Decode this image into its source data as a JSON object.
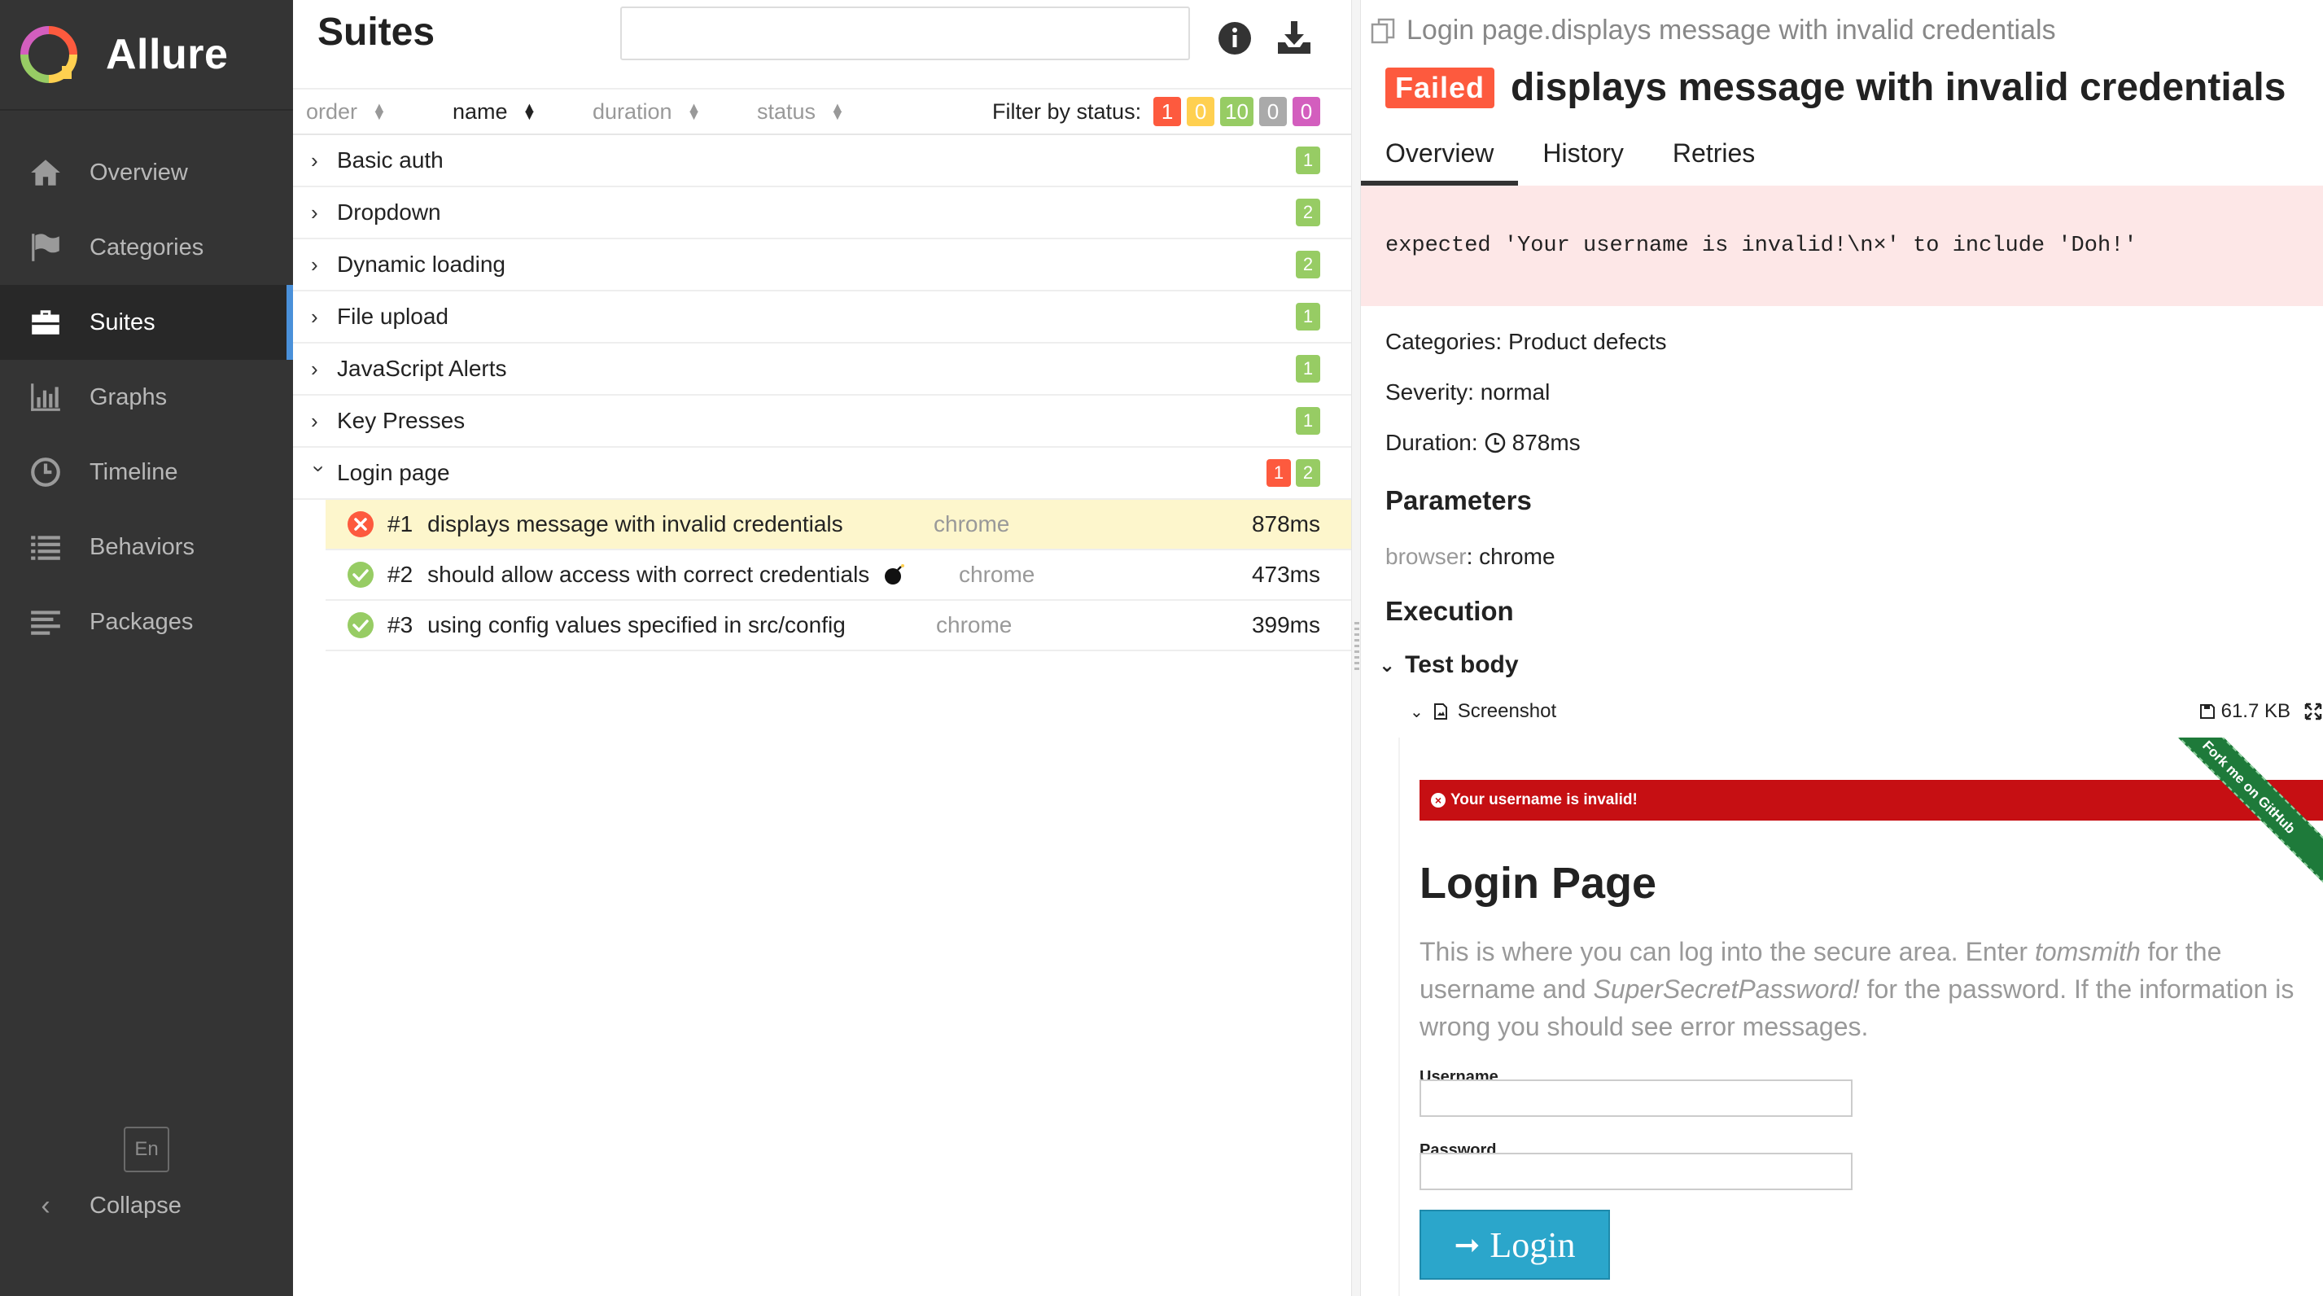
{
  "sidebar": {
    "brand": "Allure",
    "items": [
      {
        "label": "Overview",
        "icon": "home-icon"
      },
      {
        "label": "Categories",
        "icon": "flag-icon"
      },
      {
        "label": "Suites",
        "icon": "briefcase-icon",
        "active": true
      },
      {
        "label": "Graphs",
        "icon": "bar-chart-icon"
      },
      {
        "label": "Timeline",
        "icon": "clock-icon"
      },
      {
        "label": "Behaviors",
        "icon": "list-icon"
      },
      {
        "label": "Packages",
        "icon": "align-left-icon"
      }
    ],
    "language": "En",
    "collapse": "Collapse"
  },
  "suites": {
    "title": "Suites",
    "search_value": "",
    "sort": {
      "order": "order",
      "name": "name",
      "duration": "duration",
      "status": "status"
    },
    "filter_label": "Filter by status:",
    "filter_counts": {
      "failed": "1",
      "broken": "0",
      "passed": "10",
      "skipped": "0",
      "unknown": "0"
    },
    "groups": [
      {
        "name": "Basic auth",
        "passed": "1"
      },
      {
        "name": "Dropdown",
        "passed": "2"
      },
      {
        "name": "Dynamic loading",
        "passed": "2"
      },
      {
        "name": "File upload",
        "passed": "1"
      },
      {
        "name": "JavaScript Alerts",
        "passed": "1"
      },
      {
        "name": "Key Presses",
        "passed": "1"
      },
      {
        "name": "Login page",
        "failed": "1",
        "passed": "2"
      }
    ],
    "cases": [
      {
        "num": "#1",
        "name": "displays message with invalid credentials",
        "param": "chrome",
        "duration": "878ms",
        "status": "failed"
      },
      {
        "num": "#2",
        "name": "should allow access with correct credentials",
        "param": "chrome",
        "duration": "473ms",
        "status": "passed"
      },
      {
        "num": "#3",
        "name": "using config values specified in src/config",
        "param": "chrome",
        "duration": "399ms",
        "status": "passed"
      }
    ]
  },
  "detail": {
    "breadcrumb": "Login page.displays message with invalid credentials",
    "status_label": "Failed",
    "title": "displays message with invalid credentials",
    "tabs": [
      "Overview",
      "History",
      "Retries"
    ],
    "error": "expected 'Your username is invalid!\\n×' to include 'Doh!'",
    "categories_label": "Categories:",
    "categories_value": "Product defects",
    "severity_label": "Severity:",
    "severity_value": "normal",
    "duration_label": "Duration:",
    "duration_value": "878ms",
    "parameters_heading": "Parameters",
    "param_key": "browser",
    "param_value": "chrome",
    "execution_heading": "Execution",
    "test_body": "Test body",
    "attachment_name": "Screenshot",
    "attachment_size": "61.7 KB"
  },
  "screenshot": {
    "flash": "Your username is invalid!",
    "ribbon": "Fork me on GitHub",
    "heading": "Login Page",
    "p1": "This is where you can log into the secure area. Enter ",
    "p_user": "tomsmith",
    "p2": " for the username and ",
    "p_pass": "SuperSecretPassword!",
    "p3": " for the password. If the information is wrong you should see error messages.",
    "username_label": "Username",
    "password_label": "Password",
    "login_button": "Login"
  },
  "colors": {
    "failed": "#fd5a3e",
    "broken": "#ffd050",
    "passed": "#97cc64",
    "skipped": "#aaaaaa",
    "unknown": "#d35ebe",
    "sidebar": "#343434",
    "active_accent": "#4a90d9"
  }
}
